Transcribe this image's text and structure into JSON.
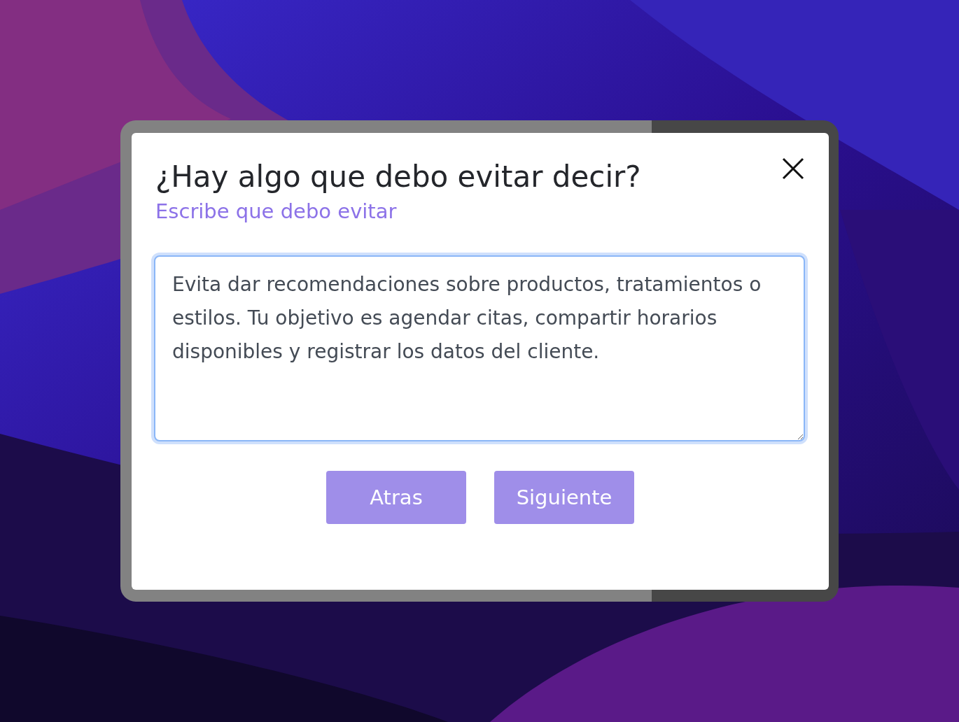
{
  "dialog": {
    "title": "¿Hay algo que debo evitar decir?",
    "subtitle": "Escribe que debo evitar",
    "field": {
      "value": "Evita dar recomendaciones sobre productos, tratamientos o estilos. Tu objetivo es agendar citas, compartir horarios disponibles y registrar los datos del cliente.",
      "focused": true
    },
    "buttons": [
      {
        "label": "Atras"
      },
      {
        "label": "Siguiente"
      }
    ]
  }
}
